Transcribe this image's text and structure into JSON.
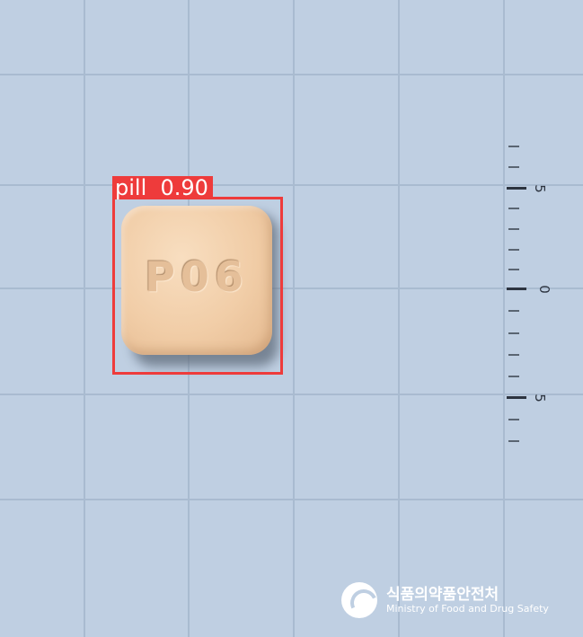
{
  "detection": {
    "label": "pill",
    "confidence": "0.90",
    "label_text": "pill  0.90",
    "box_color": "#ee3b3b"
  },
  "pill": {
    "imprint": "P06",
    "color": "#f1cda7",
    "shape": "rounded-square"
  },
  "scale": {
    "labels": [
      "5",
      "0",
      "5"
    ]
  },
  "watermark": {
    "org_korean": "식품의약품안전처",
    "org_english": "Ministry of Food and Drug Safety",
    "icon": "mfds-logo-icon"
  },
  "colors": {
    "background": "#bfcfe2",
    "grid": "#a9bbd0"
  }
}
